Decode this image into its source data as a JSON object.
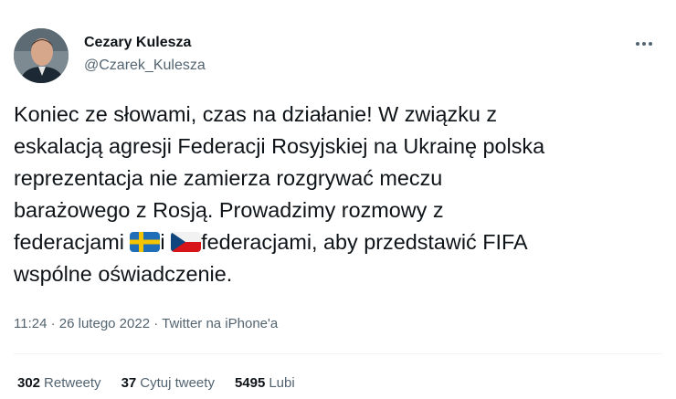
{
  "author": {
    "name": "Cezary Kulesza",
    "handle": "@Czarek_Kulesza"
  },
  "tweet": {
    "line1": "Koniec ze słowami, czas na działanie! W związku z",
    "line2": "eskalacją agresji Federacji Rosyjskiej na Ukrainę polska",
    "line3": "reprezentacja nie zamierza rozgrywać meczu",
    "line4": "barażowego z Rosją. Prowadzimy rozmowy z",
    "line5_a": "federacjami ",
    "line5_b": "i ",
    "line5_c": "federacjami, aby przedstawić FIFA",
    "line6": "wspólne oświadczenie.",
    "flags": [
      "sweden-flag-icon",
      "czech-flag-icon"
    ]
  },
  "meta": {
    "time": "11:24",
    "sep1": " · ",
    "date": "26 lutego 2022",
    "sep2": " · ",
    "source": "Twitter na iPhone'a"
  },
  "stats": {
    "retweets_count": "302",
    "retweets_label": "Retweety",
    "quotes_count": "37",
    "quotes_label": "Cytuj tweety",
    "likes_count": "5495",
    "likes_label": "Lubi"
  },
  "colors": {
    "text": "#0f1419",
    "secondary": "#536471",
    "divider": "#eff3f4"
  }
}
